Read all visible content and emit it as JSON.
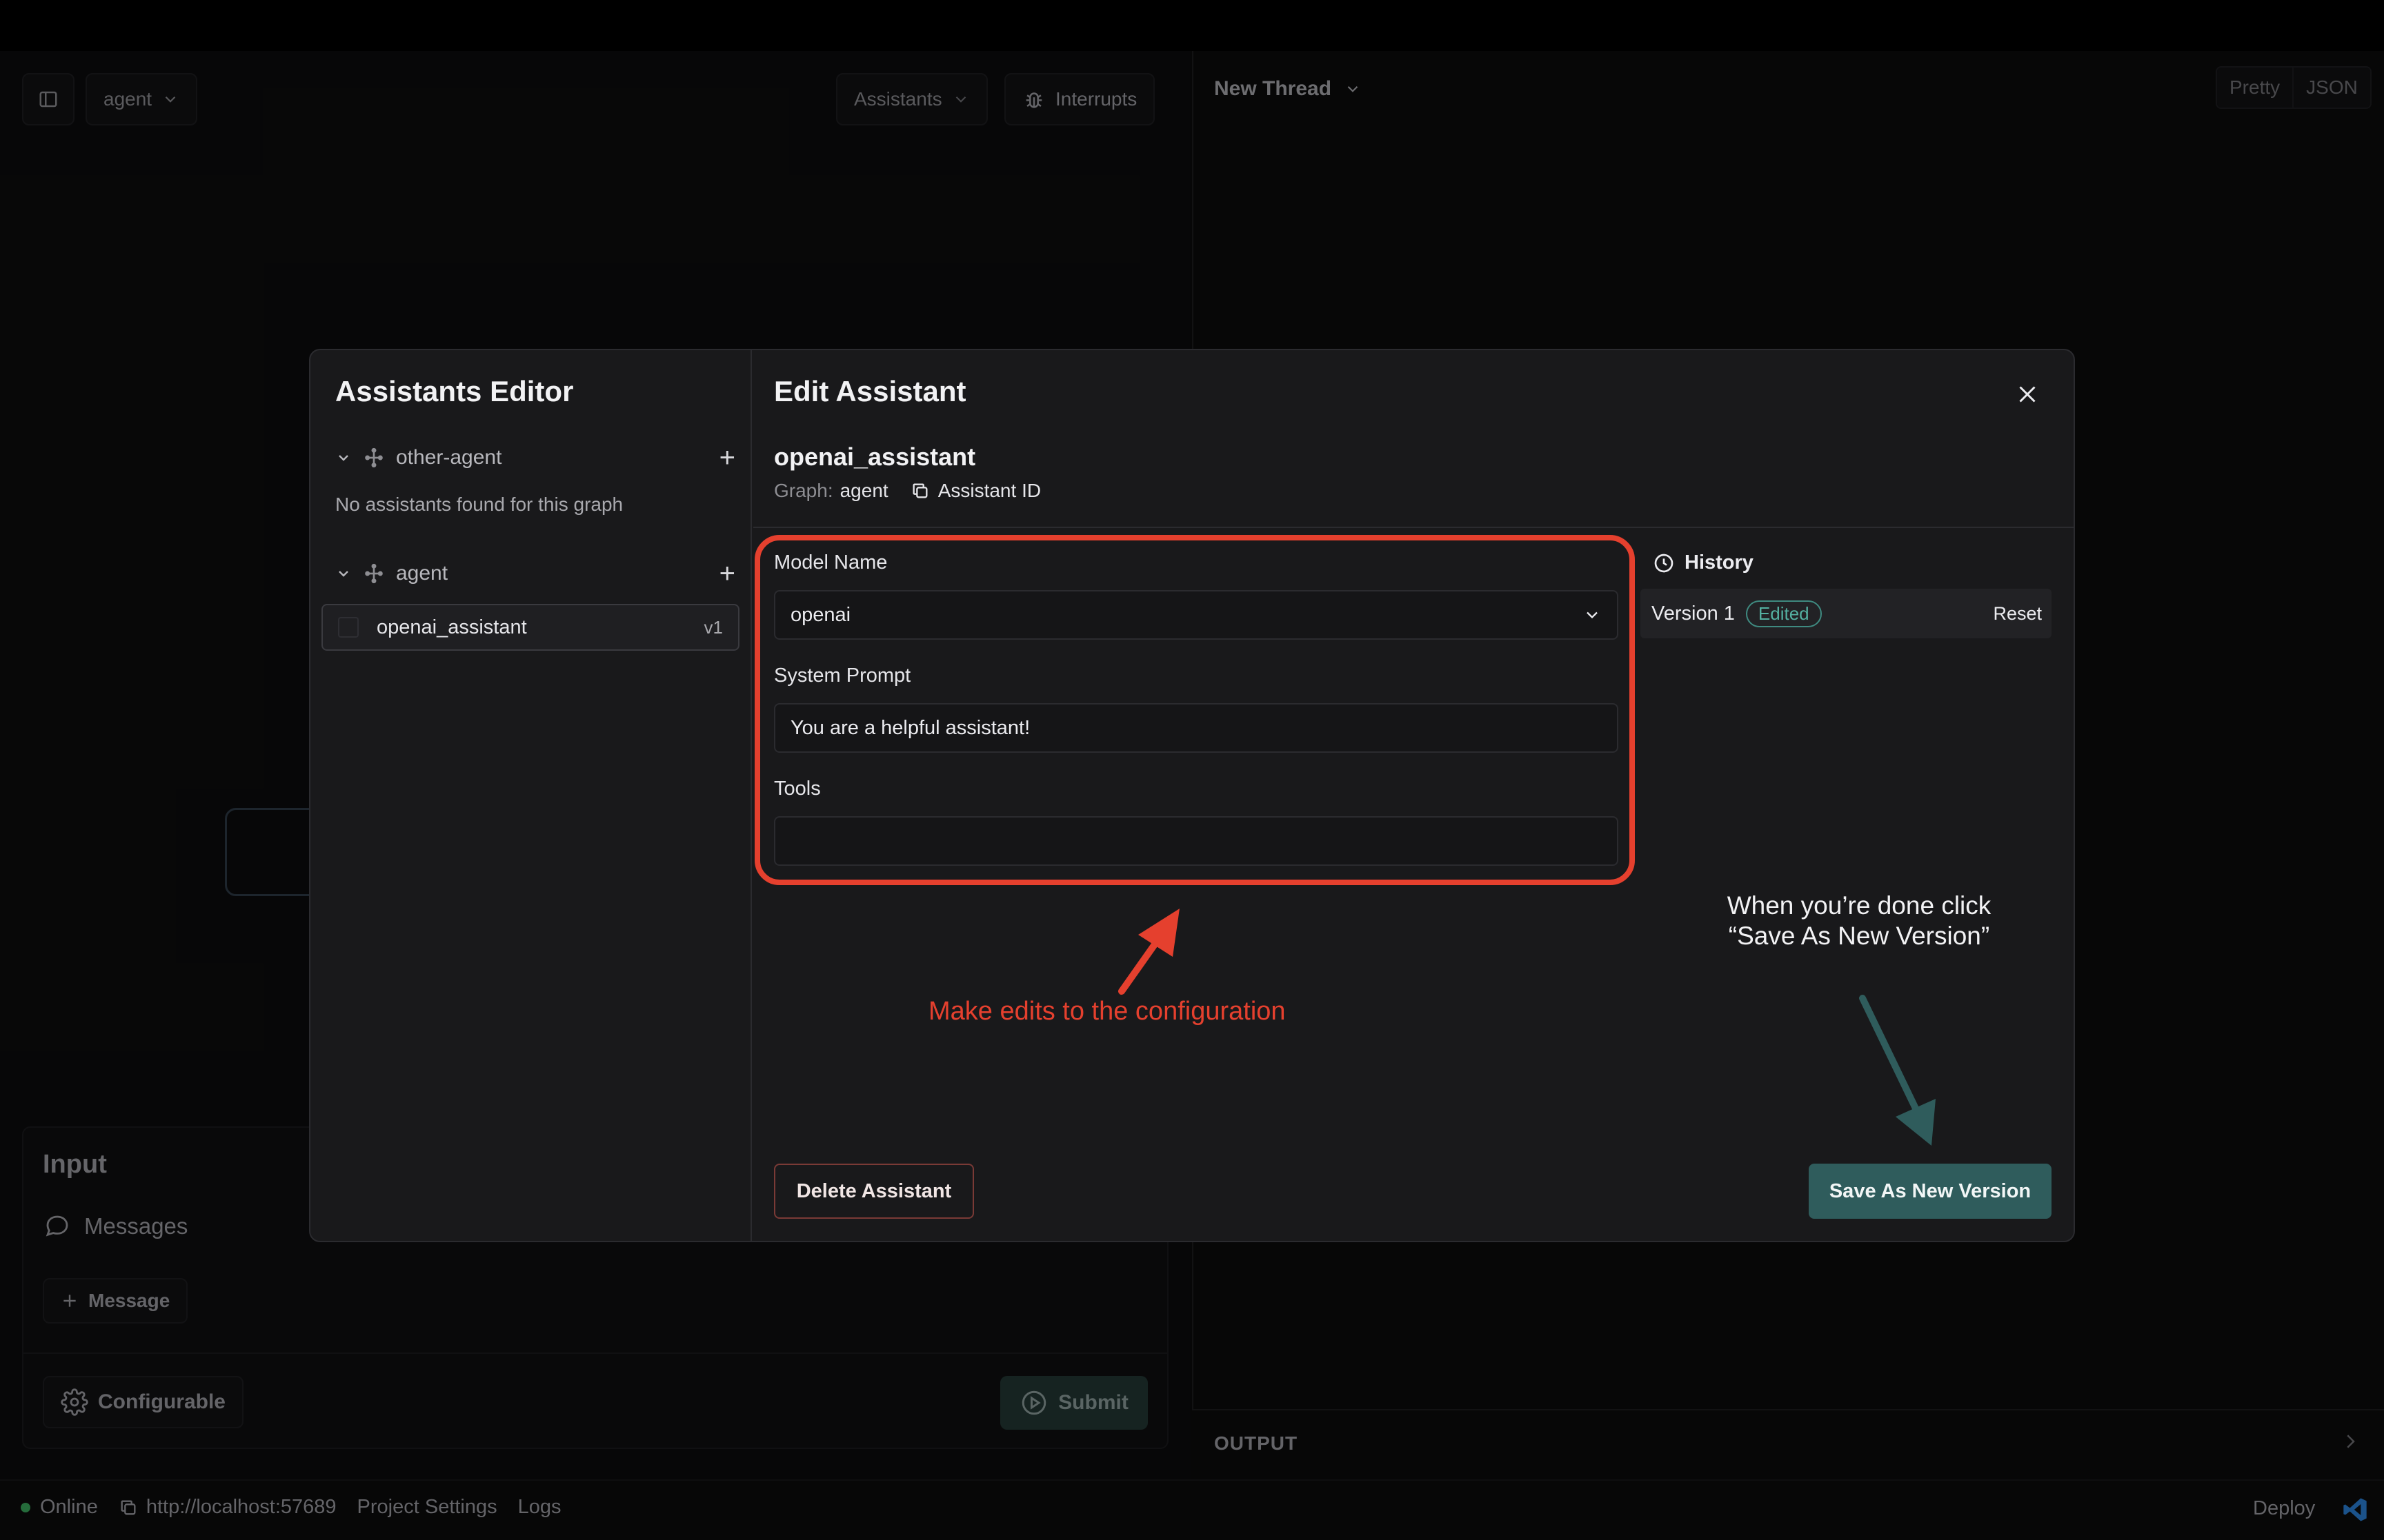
{
  "app": {
    "graph_select": "agent",
    "assistants_label": "Assistants",
    "interrupts_label": "Interrupts",
    "thread_title": "New Thread",
    "view_modes": [
      "Pretty",
      "JSON"
    ]
  },
  "input_panel": {
    "title": "Input",
    "messages_label": "Messages",
    "add_message_label": "Message",
    "configurable_label": "Configurable",
    "submit_label": "Submit"
  },
  "output": {
    "label": "OUTPUT"
  },
  "status_bar": {
    "status": "Online",
    "url": "http://localhost:57689",
    "project_settings": "Project Settings",
    "logs": "Logs",
    "deploy": "Deploy",
    "status_color": "#3aa65b"
  },
  "modal": {
    "editor_title": "Assistants Editor",
    "graphs": [
      {
        "name": "other-agent",
        "empty_text": "No assistants found for this graph"
      },
      {
        "name": "agent",
        "assistant": {
          "name": "openai_assistant",
          "version": "v1"
        }
      }
    ],
    "edit_title": "Edit Assistant",
    "assistant_name": "openai_assistant",
    "graph_label": "Graph:",
    "graph_value": "agent",
    "assistant_id_label": "Assistant ID",
    "fields": {
      "model_label": "Model Name",
      "model_value": "openai",
      "prompt_label": "System Prompt",
      "prompt_value": "You are a helpful assistant!",
      "tools_label": "Tools",
      "tools_value": ""
    },
    "history": {
      "title": "History",
      "version_label": "Version 1",
      "badge": "Edited",
      "reset_label": "Reset"
    },
    "delete_label": "Delete Assistant",
    "save_label": "Save As New Version",
    "accent_color": "#2f5c5c",
    "highlight_color": "#e5402e"
  },
  "annotations": {
    "edits_text": "Make edits to the configuration",
    "save_text": "When you’re done click “Save As New Version”"
  }
}
